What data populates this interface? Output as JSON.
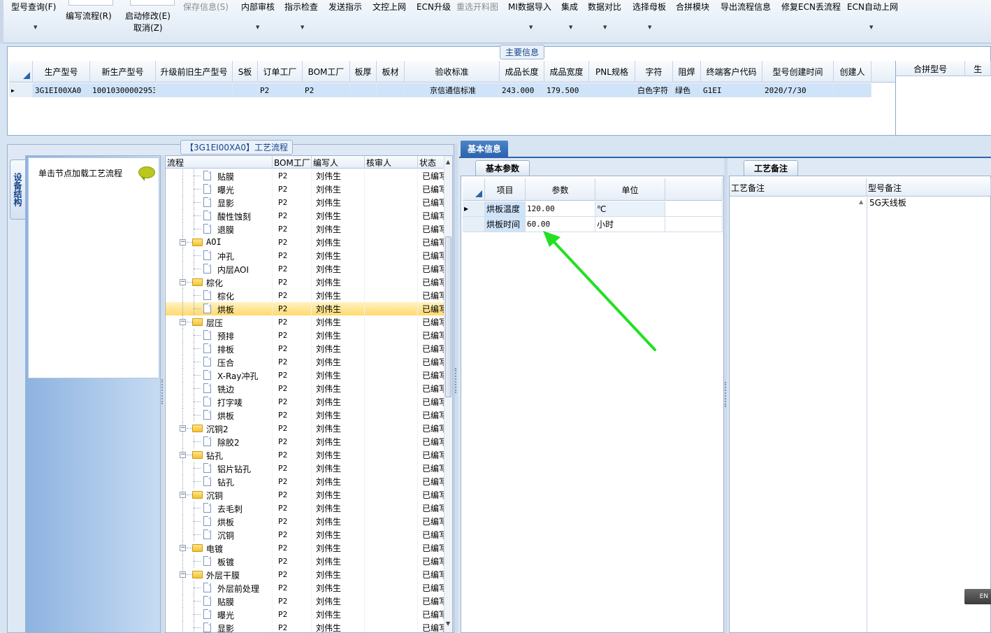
{
  "toolbar": {
    "items": [
      {
        "label": "型号查询(F)",
        "disabled": false,
        "arrow": true
      },
      {
        "label": "编写流程(R)",
        "disabled": false,
        "arrow": false
      },
      {
        "label": "启动修改(E)",
        "label2": "取消(Z)",
        "disabled": false,
        "arrow": false
      },
      {
        "label": "保存信息(S)",
        "disabled": true,
        "arrow": false
      },
      {
        "label": "内部审核",
        "disabled": false,
        "arrow": true
      },
      {
        "label": "指示检查",
        "disabled": false,
        "arrow": true
      },
      {
        "label": "发送指示",
        "disabled": false,
        "arrow": false
      },
      {
        "label": "文控上网",
        "disabled": false,
        "arrow": false
      },
      {
        "label": "ECN升级",
        "disabled": false,
        "arrow": false
      },
      {
        "label": "重选开料图",
        "disabled": true,
        "arrow": false
      },
      {
        "label": "MI数据导入",
        "disabled": false,
        "arrow": true
      },
      {
        "label": "集成",
        "disabled": false,
        "arrow": true
      },
      {
        "label": "数据对比",
        "disabled": false,
        "arrow": true
      },
      {
        "label": "选择母板",
        "disabled": false,
        "arrow": true
      },
      {
        "label": "合拼模块",
        "disabled": false,
        "arrow": false
      },
      {
        "label": "导出流程信息",
        "disabled": false,
        "arrow": false
      },
      {
        "label": "修复ECN丢流程",
        "disabled": false,
        "arrow": false
      },
      {
        "label": "ECN自动上网",
        "disabled": false,
        "arrow": true
      }
    ]
  },
  "main_info": {
    "title": "主要信息",
    "columns": [
      "生产型号",
      "新生产型号",
      "升级前旧生产型号",
      "S板",
      "订单工厂",
      "BOM工厂",
      "板厚",
      "板材",
      "验收标准",
      "成品长度",
      "成品宽度",
      "PNL规格",
      "字符",
      "阻焊",
      "终端客户代码",
      "型号创建时间",
      "创建人"
    ],
    "row": [
      "3G1EI00XA0",
      "10010300002953",
      "",
      "",
      "P2",
      "P2",
      "",
      "",
      "京信通信标准",
      "243.000",
      "179.500",
      "",
      "白色字符",
      "绿色",
      "G1EI",
      "2020/7/30",
      ""
    ],
    "merge_columns": [
      "合拼型号",
      "生"
    ]
  },
  "process": {
    "title": "【3G1EI00XA0】工艺流程",
    "side_tab": "设备结构",
    "equip_message": "单击节点加载工艺流程",
    "columns": [
      "流程",
      "BOM工厂",
      "编写人",
      "核审人",
      "状态"
    ],
    "rows": [
      {
        "name": "贴膜",
        "type": "doc",
        "bom": "P2",
        "writer": "刘伟生",
        "reviewer": "",
        "status": "已编写"
      },
      {
        "name": "曝光",
        "type": "doc",
        "bom": "P2",
        "writer": "刘伟生",
        "reviewer": "",
        "status": "已编写"
      },
      {
        "name": "显影",
        "type": "doc",
        "bom": "P2",
        "writer": "刘伟生",
        "reviewer": "",
        "status": "已编写"
      },
      {
        "name": "酸性蚀刻",
        "type": "doc",
        "bom": "P2",
        "writer": "刘伟生",
        "reviewer": "",
        "status": "已编写"
      },
      {
        "name": "退膜",
        "type": "doc",
        "bom": "P2",
        "writer": "刘伟生",
        "reviewer": "",
        "status": "已编写"
      },
      {
        "name": "AOI",
        "type": "folder",
        "bom": "P2",
        "writer": "刘伟生",
        "reviewer": "",
        "status": "已编写"
      },
      {
        "name": "冲孔",
        "type": "doc",
        "bom": "P2",
        "writer": "刘伟生",
        "reviewer": "",
        "status": "已编写"
      },
      {
        "name": "内层AOI",
        "type": "doc",
        "bom": "P2",
        "writer": "刘伟生",
        "reviewer": "",
        "status": "已编写"
      },
      {
        "name": "棕化",
        "type": "folder",
        "bom": "P2",
        "writer": "刘伟生",
        "reviewer": "",
        "status": "已编写"
      },
      {
        "name": "棕化",
        "type": "doc",
        "bom": "P2",
        "writer": "刘伟生",
        "reviewer": "",
        "status": "已编写"
      },
      {
        "name": "烘板",
        "type": "doc",
        "bom": "P2",
        "writer": "刘伟生",
        "reviewer": "",
        "status": "已编写",
        "selected": true
      },
      {
        "name": "层压",
        "type": "folder",
        "bom": "P2",
        "writer": "刘伟生",
        "reviewer": "",
        "status": "已编写"
      },
      {
        "name": "预排",
        "type": "doc",
        "bom": "P2",
        "writer": "刘伟生",
        "reviewer": "",
        "status": "已编写"
      },
      {
        "name": "排板",
        "type": "doc",
        "bom": "P2",
        "writer": "刘伟生",
        "reviewer": "",
        "status": "已编写"
      },
      {
        "name": "压合",
        "type": "doc",
        "bom": "P2",
        "writer": "刘伟生",
        "reviewer": "",
        "status": "已编写"
      },
      {
        "name": "X-Ray冲孔",
        "type": "doc",
        "bom": "P2",
        "writer": "刘伟生",
        "reviewer": "",
        "status": "已编写"
      },
      {
        "name": "铣边",
        "type": "doc",
        "bom": "P2",
        "writer": "刘伟生",
        "reviewer": "",
        "status": "已编写"
      },
      {
        "name": "打字唛",
        "type": "doc",
        "bom": "P2",
        "writer": "刘伟生",
        "reviewer": "",
        "status": "已编写"
      },
      {
        "name": "烘板",
        "type": "doc",
        "bom": "P2",
        "writer": "刘伟生",
        "reviewer": "",
        "status": "已编写"
      },
      {
        "name": "沉铜2",
        "type": "folder",
        "bom": "P2",
        "writer": "刘伟生",
        "reviewer": "",
        "status": "已编写"
      },
      {
        "name": "除胶2",
        "type": "doc",
        "bom": "P2",
        "writer": "刘伟生",
        "reviewer": "",
        "status": "已编写"
      },
      {
        "name": "钻孔",
        "type": "folder",
        "bom": "P2",
        "writer": "刘伟生",
        "reviewer": "",
        "status": "已编写"
      },
      {
        "name": "铝片钻孔",
        "type": "doc",
        "bom": "P2",
        "writer": "刘伟生",
        "reviewer": "",
        "status": "已编写"
      },
      {
        "name": "钻孔",
        "type": "doc",
        "bom": "P2",
        "writer": "刘伟生",
        "reviewer": "",
        "status": "已编写"
      },
      {
        "name": "沉铜",
        "type": "folder",
        "bom": "P2",
        "writer": "刘伟生",
        "reviewer": "",
        "status": "已编写"
      },
      {
        "name": "去毛刺",
        "type": "doc",
        "bom": "P2",
        "writer": "刘伟生",
        "reviewer": "",
        "status": "已编写"
      },
      {
        "name": "烘板",
        "type": "doc",
        "bom": "P2",
        "writer": "刘伟生",
        "reviewer": "",
        "status": "已编写"
      },
      {
        "name": "沉铜",
        "type": "doc",
        "bom": "P2",
        "writer": "刘伟生",
        "reviewer": "",
        "status": "已编写"
      },
      {
        "name": "电镀",
        "type": "folder",
        "bom": "P2",
        "writer": "刘伟生",
        "reviewer": "",
        "status": "已编写"
      },
      {
        "name": "板镀",
        "type": "doc",
        "bom": "P2",
        "writer": "刘伟生",
        "reviewer": "",
        "status": "已编写"
      },
      {
        "name": "外层干膜",
        "type": "folder",
        "bom": "P2",
        "writer": "刘伟生",
        "reviewer": "",
        "status": "已编写"
      },
      {
        "name": "外层前处理",
        "type": "doc",
        "bom": "P2",
        "writer": "刘伟生",
        "reviewer": "",
        "status": "已编写"
      },
      {
        "name": "贴膜",
        "type": "doc",
        "bom": "P2",
        "writer": "刘伟生",
        "reviewer": "",
        "status": "已编写"
      },
      {
        "name": "曝光",
        "type": "doc",
        "bom": "P2",
        "writer": "刘伟生",
        "reviewer": "",
        "status": "已编写"
      },
      {
        "name": "显影",
        "type": "doc",
        "bom": "P2",
        "writer": "刘伟生",
        "reviewer": "",
        "status": "已编写"
      }
    ]
  },
  "basic_info": {
    "tab": "基本信息",
    "params_tab": "基本参数",
    "notes_tab": "工艺备注",
    "param_columns": [
      "项目",
      "参数",
      "单位"
    ],
    "params": [
      {
        "item": "烘板温度",
        "value": "120.00",
        "unit": "℃"
      },
      {
        "item": "烘板时间",
        "value": "60.00",
        "unit": "小时"
      }
    ],
    "note_columns": [
      "工艺备注",
      "型号备注"
    ],
    "model_note": "5G天线板"
  },
  "status_badge": "EN",
  "colors": {
    "accent": "#2c64ad",
    "selection": "#ffd96e",
    "arrow": "#22e022"
  }
}
